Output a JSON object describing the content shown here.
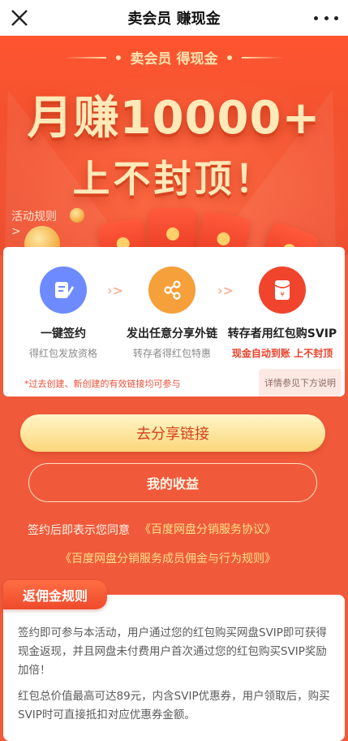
{
  "topbar": {
    "title": "卖会员 赚现金"
  },
  "hero": {
    "tag": "卖会员 得现金",
    "headline": "月赚10000+",
    "subline": "上不封顶！",
    "rules_link": "活动规则\n>"
  },
  "steps": [
    {
      "name": "一键签约",
      "desc": "得红包发放资格",
      "icon": "contract-icon",
      "color": "#6d8bff"
    },
    {
      "name": "发出任意分享外链",
      "desc": "转存者得红包特惠",
      "icon": "share-icon",
      "color": "#f5a03a"
    },
    {
      "name": "转存者用红包购SVIP",
      "desc": "现金自动到账 上不封顶",
      "icon": "red-envelope-icon",
      "color": "#f0442c"
    }
  ],
  "notice": "*过去创建、新创建的有效链接均可参与",
  "details_chip": "详情参见下方说明",
  "share_button": "去分享链接",
  "earnings_button": "我的收益",
  "agreement": {
    "prefix": "签约后即表示您同意",
    "link1": "《百度网盘分销服务协议》",
    "link2": "《百度网盘分销服务成员佣金与行为规则》"
  },
  "rules": {
    "tab": "返佣金规则",
    "para1": "签约即可参与本活动，用户通过您的红包购买网盘SVIP即可获得现金返现，并且网盘未付费用户首次通过您的红包购买SVIP奖励加倍！",
    "para2": "红包总价值最高可达89元，内含SVIP优惠券，用户领取后，购买SVIP时可直接抵扣对应优惠券金额。"
  }
}
